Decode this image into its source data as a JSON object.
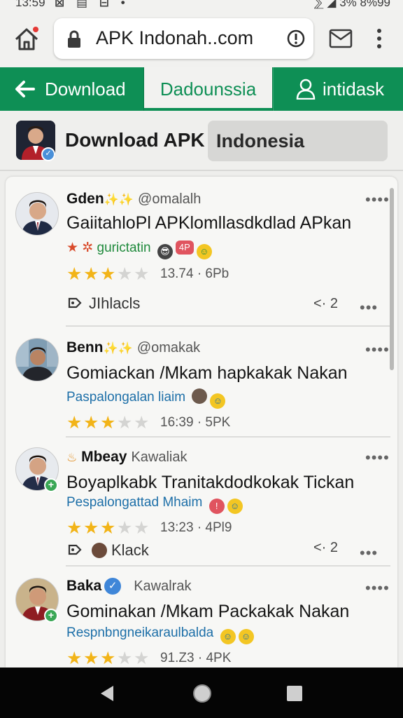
{
  "status_bar": {
    "time": "13:59",
    "icons": "⊠ ▤ ⊟ •",
    "right": "⅀ ◢ 3% 8%99"
  },
  "browser": {
    "url": "APK Indonah..com"
  },
  "tabs": [
    {
      "label": "Download"
    },
    {
      "label": "Dadounssia"
    },
    {
      "label": "intidask"
    }
  ],
  "app": {
    "title": "Download APK",
    "country": "Indonesia"
  },
  "posts": [
    {
      "name": "Gden",
      "badges": "✨✨",
      "handle": "@omalalh",
      "text": "GaiitahloPl APKlomllasdkdlad APkan",
      "sub": "gurictatin",
      "sub_prefix": "★ ✲",
      "pill": "4P",
      "rating": 3,
      "meta": "13.74 · 6Pb",
      "action": "JIhlacls",
      "share": "2"
    },
    {
      "name": "Benn",
      "badges": "✨✨",
      "handle": "@omakak",
      "text": "Gomiackan /Mkam hapkakak Nakan",
      "sub": "Paspalongalan liaim",
      "rating": 3,
      "meta": "16:39 · 5PK"
    },
    {
      "name": "Mbeay",
      "handle": "Kawaliak",
      "text": "Boyaplkabk Tranitakdodkokak Tickan",
      "sub": "Pespalongattad Mhaim",
      "rating": 3,
      "meta": "13:23 · 4Pl9",
      "action": "Klack",
      "share": "2"
    },
    {
      "name": "Baka",
      "handle": "Kawalrak",
      "text": "Gominakan /Mkam Packakak Nakan",
      "sub": "Respnbngneikaraulbalda",
      "rating": 3,
      "meta": "91.Z3 · 4PK"
    }
  ],
  "colors": {
    "green": "#0e8f55",
    "star": "#f2b418"
  }
}
